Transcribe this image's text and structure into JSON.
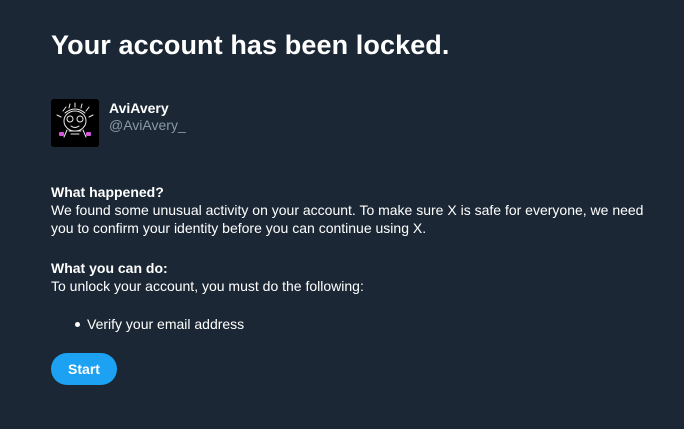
{
  "page": {
    "title": "Your account has been locked."
  },
  "profile": {
    "display_name": "AviAvery",
    "handle": "@AviAvery_",
    "avatar_icon": "avatar-drawing-icon"
  },
  "what_happened": {
    "heading": "What happened?",
    "body": "We found some unusual activity on your account. To make sure X is safe for everyone, we need you to confirm your identity before you can continue using X."
  },
  "what_you_can_do": {
    "heading": "What you can do:",
    "body": "To unlock your account, you must do the following:",
    "steps": [
      "Verify your email address"
    ]
  },
  "actions": {
    "start_label": "Start"
  },
  "colors": {
    "background": "#1b2734",
    "accent": "#1da1f2",
    "secondary_text": "#8899a6"
  }
}
